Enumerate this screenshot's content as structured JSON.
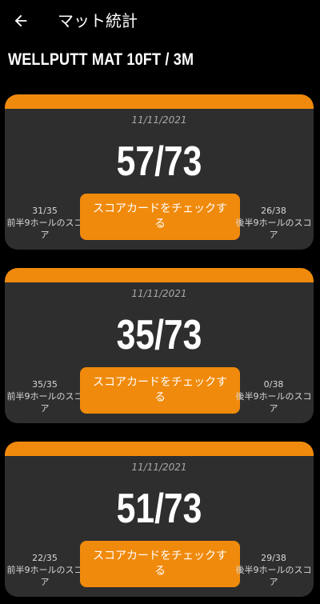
{
  "header": {
    "back_icon": "arrow-left-icon",
    "title": "マット統計"
  },
  "mat": {
    "name": "WELLPUTT MAT 10FT / 3M"
  },
  "colors": {
    "accent": "#f08a0c",
    "card": "#2e2e2e",
    "background": "#000000"
  },
  "cards": [
    {
      "date": "11/11/2021",
      "score": "57/73",
      "front": {
        "value": "31/35",
        "label": "前半9ホールのスコア"
      },
      "back": {
        "value": "26/38",
        "label": "後半9ホールのスコア"
      },
      "button": "スコアカードをチェックする"
    },
    {
      "date": "11/11/2021",
      "score": "35/73",
      "front": {
        "value": "35/35",
        "label": "前半9ホールのスコア"
      },
      "back": {
        "value": "0/38",
        "label": "後半9ホールのスコア"
      },
      "button": "スコアカードをチェックする"
    },
    {
      "date": "11/11/2021",
      "score": "51/73",
      "front": {
        "value": "22/35",
        "label": "前半9ホールのスコア"
      },
      "back": {
        "value": "29/38",
        "label": "後半9ホールのスコア"
      },
      "button": "スコアカードをチェックする"
    }
  ]
}
